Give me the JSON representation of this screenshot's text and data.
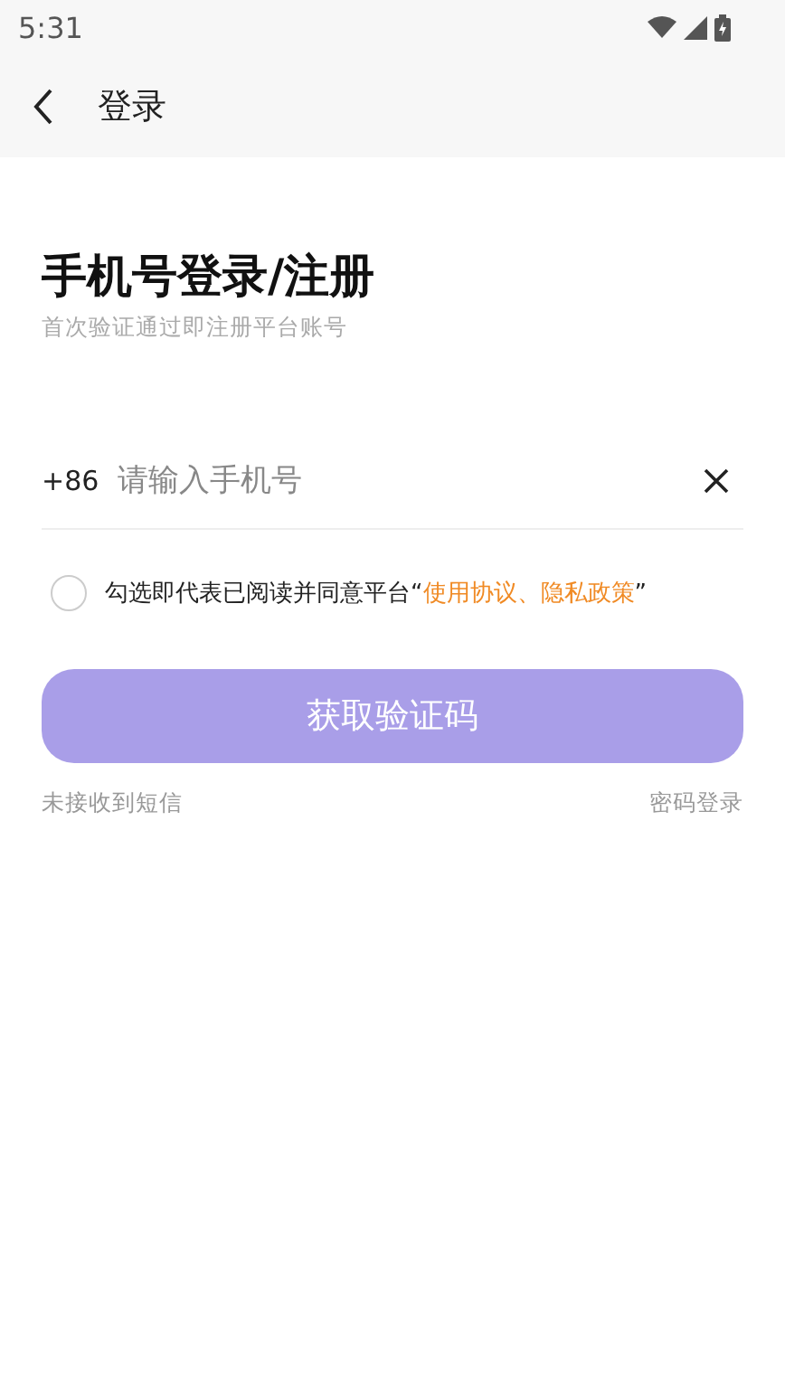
{
  "status_bar": {
    "time": "5:31"
  },
  "header": {
    "title": "登录"
  },
  "heading": "手机号登录/注册",
  "subheading": "首次验证通过即注册平台账号",
  "phone": {
    "prefix": "+86",
    "placeholder": "请输入手机号"
  },
  "agreement": {
    "checked": false,
    "prefix": "勾选即代表已阅读并同意平台“",
    "links": [
      "使用协议",
      "隐私政策"
    ],
    "separator": "、",
    "suffix": "”"
  },
  "submit": {
    "label": "获取验证码",
    "disabled": true
  },
  "footer_links": [
    "未接收到短信",
    "密码登录"
  ]
}
